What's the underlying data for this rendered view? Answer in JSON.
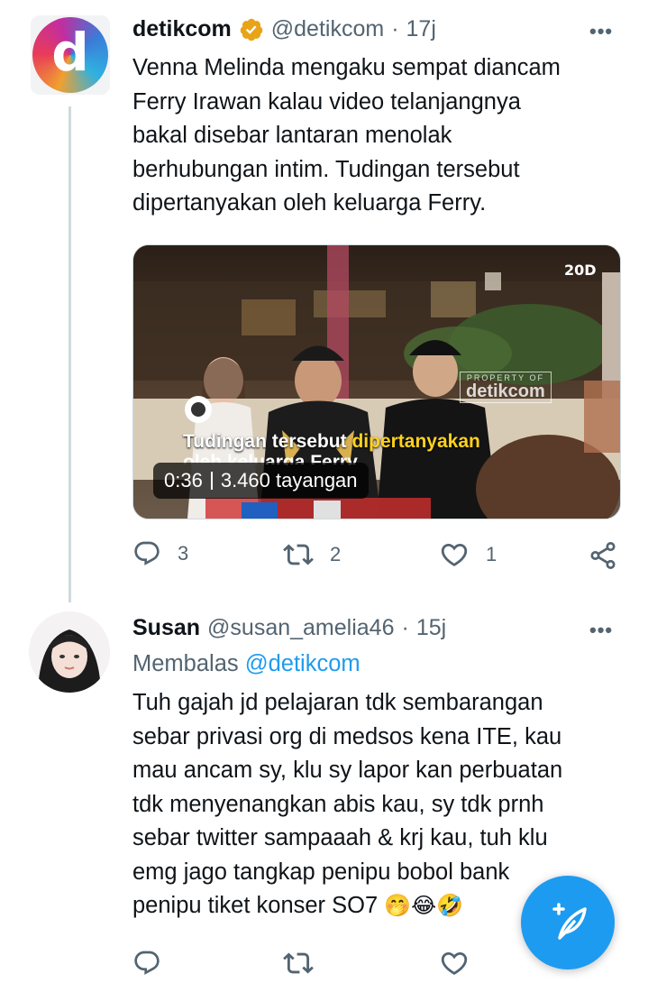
{
  "tweet1": {
    "avatar_letter": "d",
    "name": "detikcom",
    "handle": "@detikcom",
    "separator": "·",
    "time": "17j",
    "more": "•••",
    "lines": [
      "Venna Melinda mengaku sempat diancam",
      "Ferry Irawan kalau video telanjangnya",
      "bakal disebar lantaran menolak",
      "berhubungan intim. Tudingan tersebut",
      "dipertanyakan oleh keluarga Ferry."
    ],
    "video": {
      "channel_logo": "20D",
      "watermark_top": "PROPERTY OF",
      "watermark_brand": "detikcom",
      "caption_white": "Tudingan tersebut ",
      "caption_yellow": "dipertanyakan",
      "caption_line2": "oleh keluarga Ferry",
      "duration": "0:36",
      "views": "3.460 tayangan"
    },
    "actions": {
      "replies": "3",
      "retweets": "2",
      "likes": "1"
    }
  },
  "tweet2": {
    "name": "Susan",
    "handle": "@susan_amelia46",
    "separator": "·",
    "time": "15j",
    "more": "•••",
    "reply_prefix": "Membalas ",
    "reply_mention": "@detikcom",
    "lines": [
      "Tuh gajah jd pelajaran tdk sembarangan",
      "sebar privasi org di medsos kena ITE, kau",
      "mau ancam sy, klu sy lapor kan perbuatan",
      "tdk menyenangkan abis kau, sy tdk prnh",
      "sebar twitter sampaaah & krj kau, tuh klu",
      "emg jago tangkap penipu bobol bank",
      "penipu tiket konser SO7 "
    ],
    "emojis": "🤭😂🤣"
  },
  "fab": {
    "icon": "compose-icon"
  },
  "colors": {
    "accent": "#1d9bf0",
    "muted": "#536471",
    "verified": "#e8a317"
  }
}
